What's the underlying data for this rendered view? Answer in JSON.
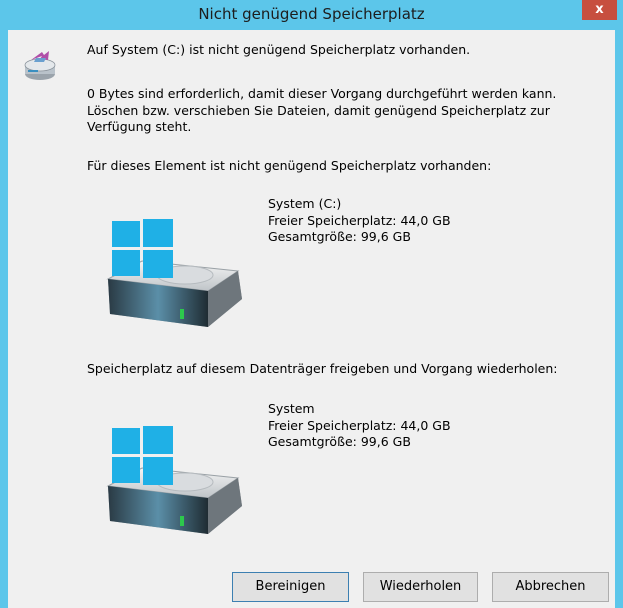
{
  "window": {
    "title": "Nicht genügend Speicherplatz",
    "close_label": "x"
  },
  "message": {
    "main": "Auf System (C:) ist nicht genügend Speicherplatz vorhanden.",
    "detail_line1": "0 Bytes sind erforderlich, damit dieser Vorgang durchgeführt werden kann.",
    "detail_line2": "Löschen bzw. verschieben Sie Dateien, damit genügend Speicherplatz zur",
    "detail_line3": "Verfügung steht."
  },
  "item_section": {
    "label": "Für dieses Element ist nicht genügend Speicherplatz vorhanden:",
    "drive_name": "System (C:)",
    "free": "Freier Speicherplatz: 44,0 GB",
    "total": "Gesamtgröße: 99,6 GB"
  },
  "free_section": {
    "label": "Speicherplatz auf diesem Datenträger freigeben und Vorgang wiederholen:",
    "drive_name": "System",
    "free": "Freier Speicherplatz: 44,0 GB",
    "total": "Gesamtgröße: 99,6 GB"
  },
  "buttons": {
    "clean": "Bereinigen",
    "retry": "Wiederholen",
    "cancel": "Abbrechen"
  },
  "icons": {
    "header": "drive-cleanup-icon",
    "drive": "windows-hard-drive-icon"
  },
  "colors": {
    "titlebar": "#5cc6ea",
    "close": "#c74f3f",
    "background": "#f0f0f0"
  }
}
